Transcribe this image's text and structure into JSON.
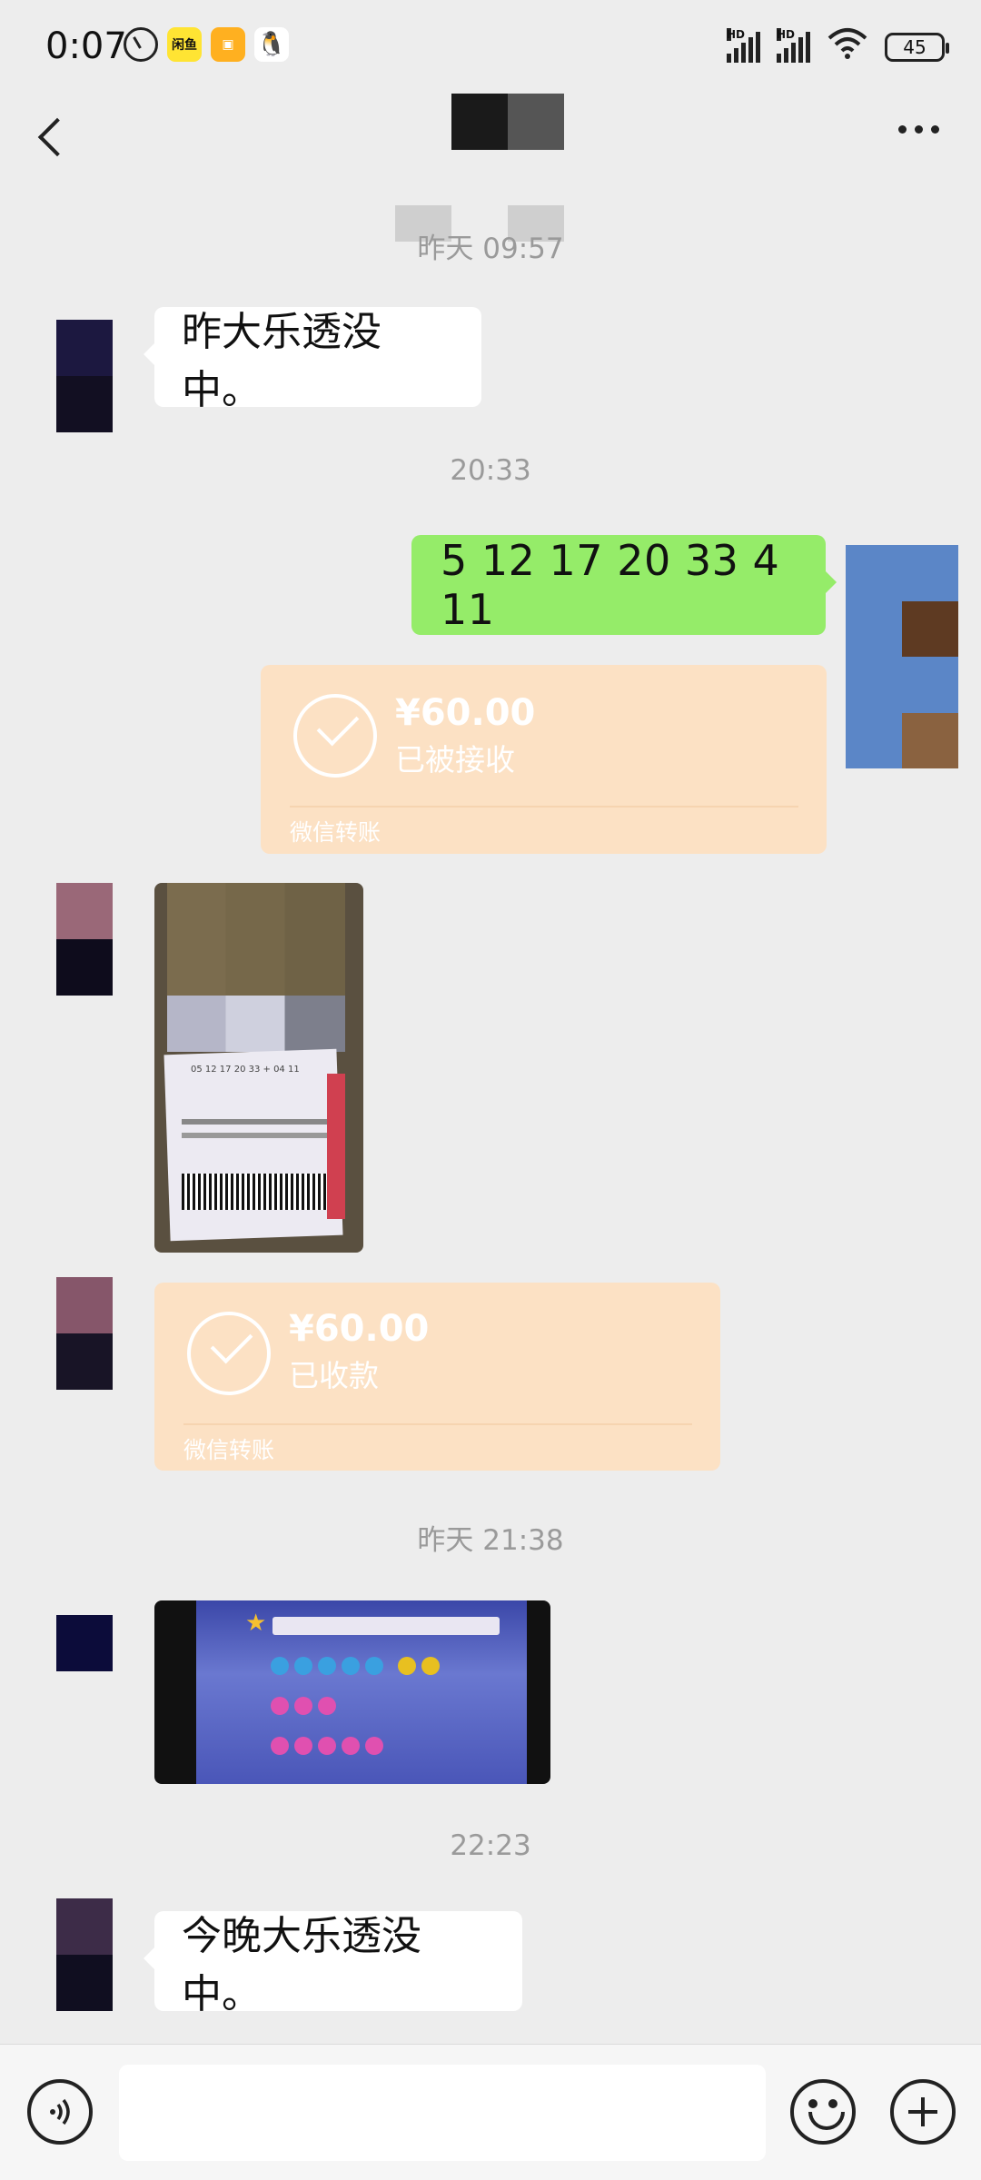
{
  "status_bar": {
    "time": "0:07",
    "app_badge_1": "闲鱼",
    "battery": "45",
    "network": "HD"
  },
  "header": {
    "title": ""
  },
  "messages": {
    "ts1": "昨天 09:57",
    "msg1": "昨大乐透没中。",
    "ts2": "20:33",
    "out_numbers": "5 12 17 20 33   4 11",
    "transfer1": {
      "amount": "¥60.00",
      "status": "已被接收",
      "label": "微信转账"
    },
    "transfer2": {
      "amount": "¥60.00",
      "status": "已收款",
      "label": "微信转账"
    },
    "ts3": "昨天 21:38",
    "ts4": "22:23",
    "msg2": "今晚大乐透没中。"
  },
  "colors": {
    "background": "#ededed",
    "outgoing_bubble": "#95ec69",
    "transfer_bubble": "#fce1c4"
  }
}
